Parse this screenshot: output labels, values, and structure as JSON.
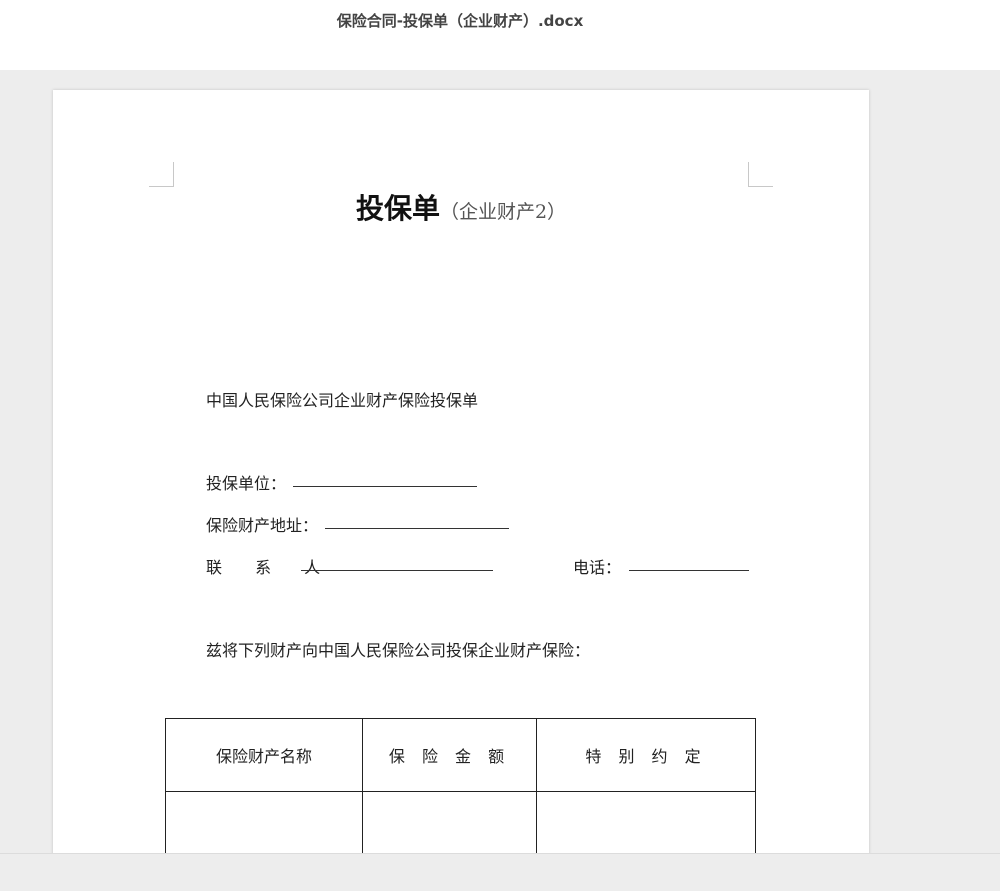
{
  "window": {
    "title": "保险合同-投保单（企业财产）.docx"
  },
  "document": {
    "heading_main": "投保单",
    "heading_sub": "（企业财产2）",
    "company_line": "中国人民保险公司企业财产保险投保单",
    "fields": {
      "insured_unit_label": "投保单位：",
      "property_address_label": "保险财产地址：",
      "contact_label": "联 系 人",
      "phone_label": "电话："
    },
    "statement": "兹将下列财产向中国人民保险公司投保企业财产保险：",
    "table": {
      "headers": [
        "保险财产名称",
        "保 险 金 额",
        "特 别 约 定"
      ]
    }
  }
}
